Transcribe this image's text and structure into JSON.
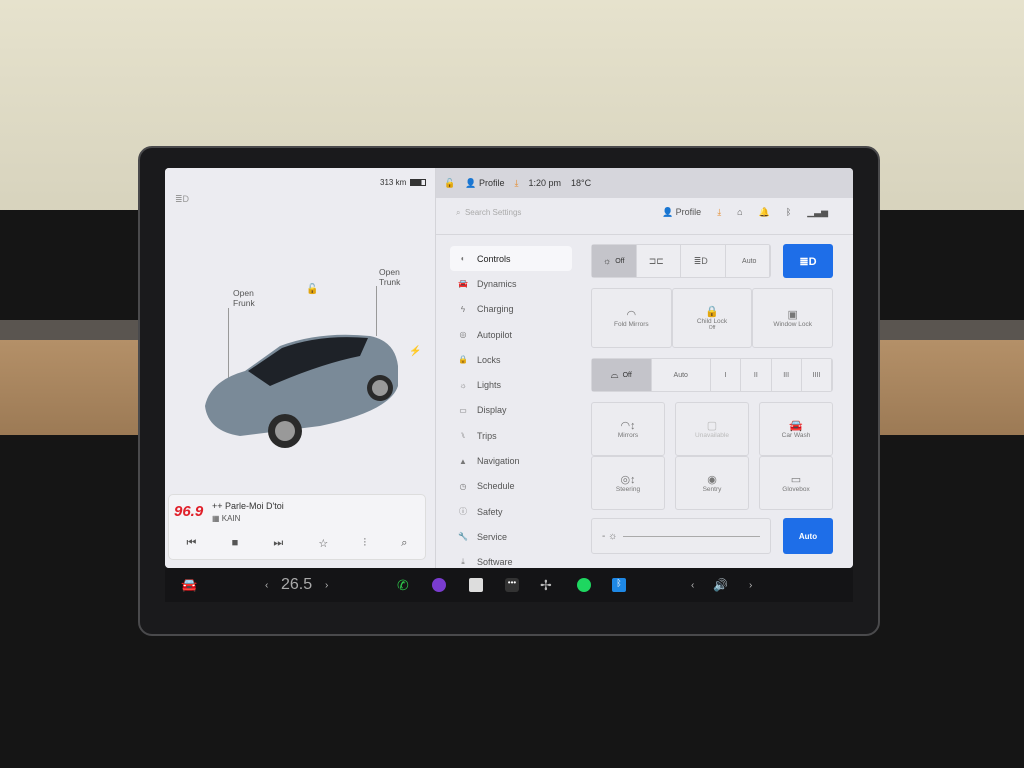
{
  "status": {
    "range": "313 km",
    "profile": "Profile",
    "time": "1:20 pm",
    "temp": "18°C"
  },
  "left": {
    "open_frunk": "Open\nFrunk",
    "open_trunk": "Open\nTrunk"
  },
  "media": {
    "station_logo": "96.9",
    "title": "++ Parle-Moi D'toi",
    "artist": "KAIN"
  },
  "settings": {
    "search_placeholder": "Search Settings",
    "profile": "Profile"
  },
  "menu": [
    {
      "label": "Controls",
      "icon": "toggle-icon"
    },
    {
      "label": "Dynamics",
      "icon": "car-icon"
    },
    {
      "label": "Charging",
      "icon": "bolt-icon"
    },
    {
      "label": "Autopilot",
      "icon": "steering-wheel-icon"
    },
    {
      "label": "Locks",
      "icon": "lock-icon"
    },
    {
      "label": "Lights",
      "icon": "sun-icon"
    },
    {
      "label": "Display",
      "icon": "display-icon"
    },
    {
      "label": "Trips",
      "icon": "trips-icon"
    },
    {
      "label": "Navigation",
      "icon": "navigation-icon"
    },
    {
      "label": "Schedule",
      "icon": "clock-icon"
    },
    {
      "label": "Safety",
      "icon": "info-icon"
    },
    {
      "label": "Service",
      "icon": "wrench-icon"
    },
    {
      "label": "Software",
      "icon": "download-icon"
    }
  ],
  "lights": {
    "options": [
      "Off",
      "",
      "",
      "Auto"
    ],
    "selected": "Off"
  },
  "row2": [
    "Fold Mirrors",
    "Child Lock",
    "Window Lock"
  ],
  "child_lock_state": "Off",
  "wipers": {
    "options": [
      "Off",
      "Auto",
      "I",
      "II",
      "III",
      "IIII"
    ],
    "selected": "Off"
  },
  "grid": [
    "Mirrors",
    "Unavailable",
    "Car Wash",
    "Steering",
    "Sentry",
    "Glovebox"
  ],
  "brightness": {
    "auto_label": "Auto"
  },
  "taskbar": {
    "temperature": "26.5"
  },
  "colors": {
    "accent": "#1e6ee8",
    "station": "#e0202a"
  }
}
